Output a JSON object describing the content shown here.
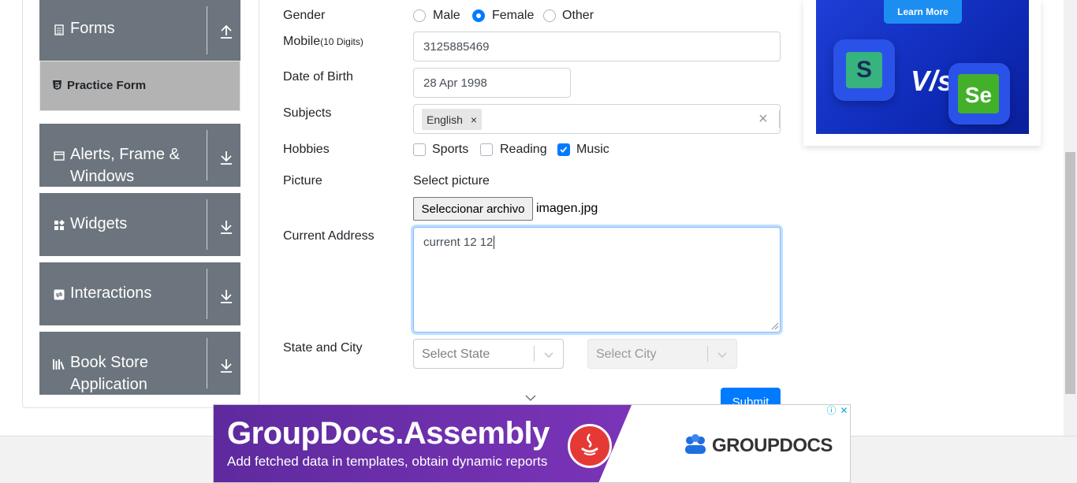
{
  "sidebar": {
    "groups": [
      {
        "label": "Forms",
        "icon": "document-icon",
        "arrow": "up"
      },
      {
        "label": "Alerts, Frame &",
        "label2": "Windows",
        "icon": "window-icon",
        "arrow": "down"
      },
      {
        "label": "Widgets",
        "icon": "widgets-icon",
        "arrow": "down"
      },
      {
        "label": "Interactions",
        "icon": "interactions-icon",
        "arrow": "down"
      },
      {
        "label": "Book Store",
        "label2": "Application",
        "icon": "books-icon",
        "arrow": "down"
      }
    ],
    "active_item": "Practice Form"
  },
  "form": {
    "gender": {
      "label": "Gender",
      "options": [
        "Male",
        "Female",
        "Other"
      ],
      "selected": "Female"
    },
    "mobile": {
      "label": "Mobile",
      "hint": "(10 Digits)",
      "value": "3125885469"
    },
    "dob": {
      "label": "Date of Birth",
      "value": "28 Apr 1998"
    },
    "subjects": {
      "label": "Subjects",
      "chips": [
        "English"
      ],
      "remove_glyph": "×",
      "clear_glyph": "×"
    },
    "hobbies": {
      "label": "Hobbies",
      "options": [
        "Sports",
        "Reading",
        "Music"
      ],
      "checked": [
        "Music"
      ]
    },
    "picture": {
      "label": "Picture",
      "prompt": "Select picture",
      "button": "Seleccionar archivo",
      "file": "imagen.jpg"
    },
    "address": {
      "label": "Current Address",
      "value": "current 12 12"
    },
    "state_city": {
      "label": "State and City",
      "state_placeholder": "Select State",
      "city_placeholder": "Select City"
    },
    "submit": "Submit"
  },
  "right_ad": {
    "button": "Learn More",
    "vs": "V/s",
    "left_logo": "S",
    "right_logo": "Se"
  },
  "bottom_ad": {
    "title": "GroupDocs.Assembly",
    "subtitle": "Add fetched data in templates, obtain dynamic reports",
    "brand": "GROUPDOCS",
    "info_glyph": "ⓘ",
    "close_glyph": "✕"
  },
  "colors": {
    "sidebar_group": "#6c757d",
    "active_item": "#b3b3b3",
    "primary": "#007bff",
    "ad_purple": "#6b2fae",
    "ad_blue": "#1e3fd6"
  }
}
